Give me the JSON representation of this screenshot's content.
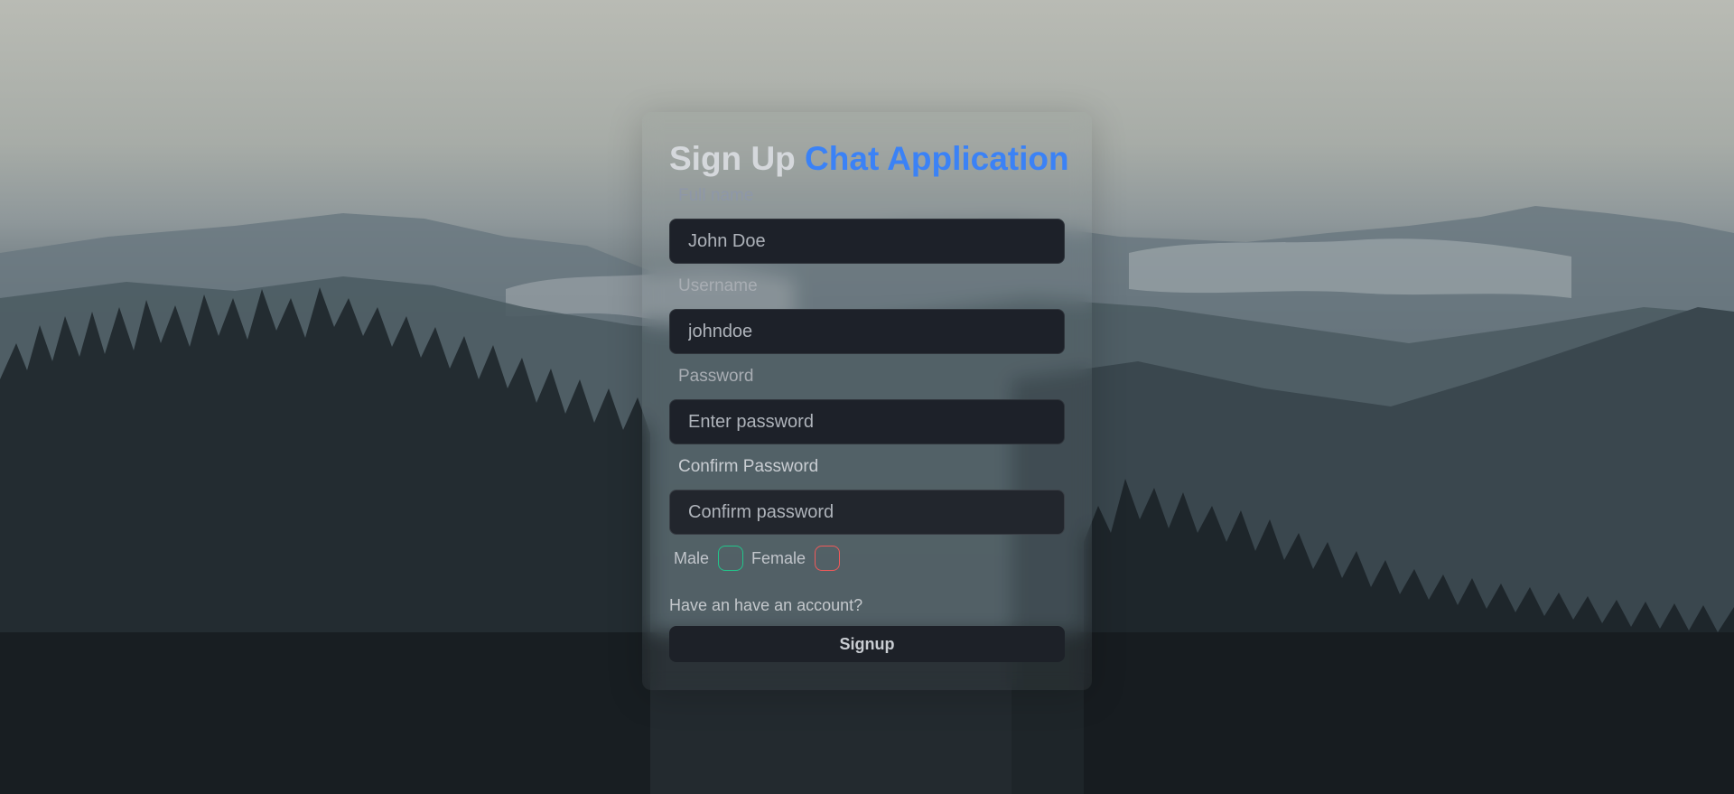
{
  "signup": {
    "title_prefix": "Sign Up",
    "title_accent": "Chat Application",
    "fields": {
      "full_name": {
        "label": "Full name",
        "placeholder": "John Doe"
      },
      "username": {
        "label": "Username",
        "placeholder": "johndoe"
      },
      "password": {
        "label": "Password",
        "placeholder": "Enter password"
      },
      "confirm_password": {
        "label": "Confirm Password",
        "placeholder": "Confirm password"
      }
    },
    "gender": {
      "male_label": "Male",
      "female_label": "Female",
      "male_color": "#22c58b",
      "female_color": "#f05a5a"
    },
    "login_link": "Have an have an account?",
    "submit_label": "Signup"
  },
  "theme": {
    "accent": "#3b82f6",
    "input_bg": "#1d2129"
  }
}
